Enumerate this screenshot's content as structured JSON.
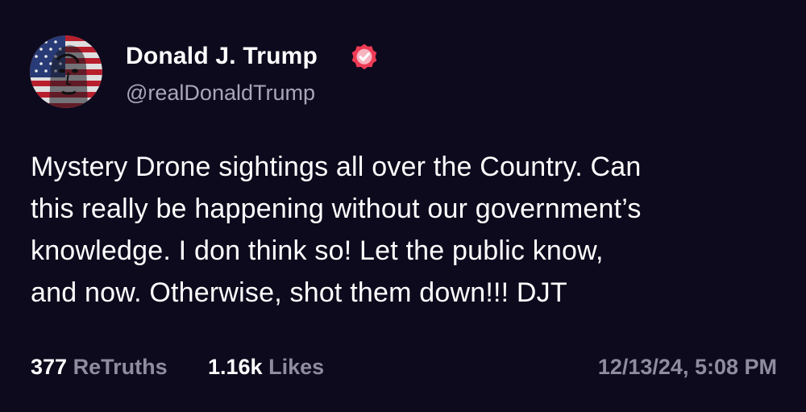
{
  "author": {
    "display_name": "Donald J. Trump",
    "handle": "@realDonaldTrump",
    "avatar_icon": "profile-portrait-flag-icon",
    "verified_icon": "verified-check-icon",
    "verified_color": "#ee3b55"
  },
  "post": {
    "text": "Mystery Drone sightings all over the Country. Can\nthis really be happening without our government’s\nknowledge. I don think so! Let the public know,\nand now. Otherwise, shot them down!!! DJT"
  },
  "stats": {
    "retruths_count": "377",
    "retruths_label": "ReTruths",
    "likes_count": "1.16k",
    "likes_label": "Likes"
  },
  "timestamp": "12/13/24, 5:08 PM",
  "colors": {
    "background": "#0d0a1d",
    "text": "#ffffff",
    "muted": "#8f8ca0"
  }
}
